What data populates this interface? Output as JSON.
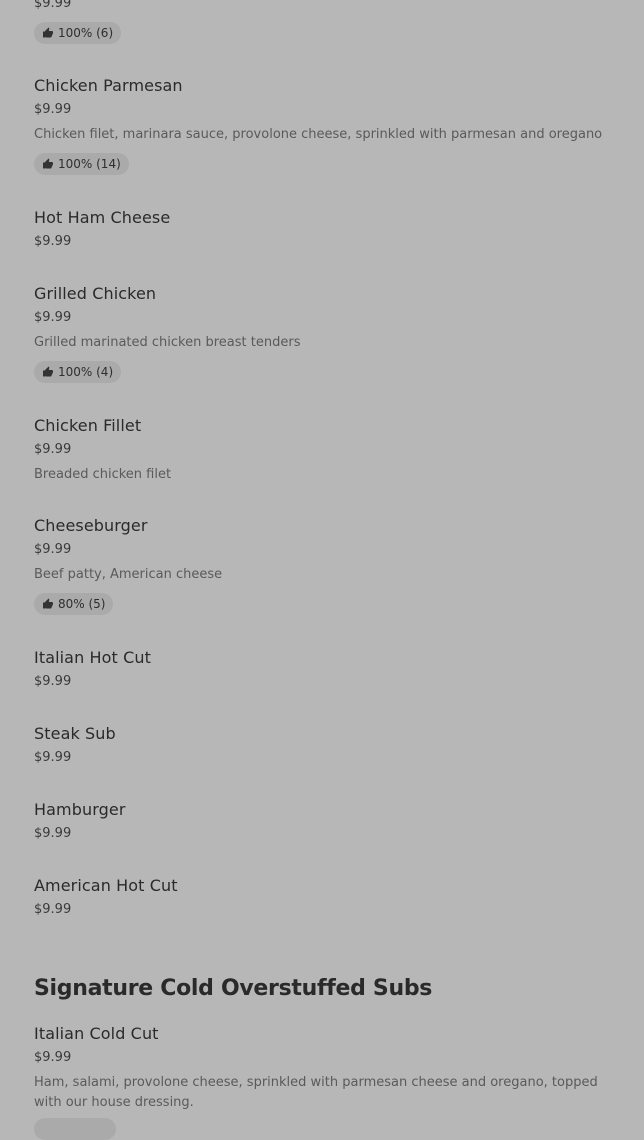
{
  "top": {
    "price": "$9.99",
    "rating": "100% (6)"
  },
  "items": [
    {
      "name": "Chicken Parmesan",
      "price": "$9.99",
      "description": "Chicken filet, marinara sauce, provolone cheese, sprinkled with parmesan and oregano",
      "rating": "100% (14)"
    },
    {
      "name": "Hot Ham Cheese",
      "price": "$9.99"
    },
    {
      "name": "Grilled Chicken",
      "price": "$9.99",
      "description": "Grilled marinated chicken breast tenders",
      "rating": "100% (4)"
    },
    {
      "name": "Chicken Fillet",
      "price": "$9.99",
      "description": "Breaded chicken filet"
    },
    {
      "name": "Cheeseburger",
      "price": "$9.99",
      "description": "Beef patty, American cheese",
      "rating": "80% (5)"
    },
    {
      "name": "Italian Hot Cut",
      "price": "$9.99"
    },
    {
      "name": "Steak Sub",
      "price": "$9.99"
    },
    {
      "name": "Hamburger",
      "price": "$9.99"
    },
    {
      "name": "American Hot Cut",
      "price": "$9.99"
    }
  ],
  "section": {
    "title": "Signature Cold Overstuffed Subs",
    "items": [
      {
        "name": "Italian Cold Cut",
        "price": "$9.99",
        "description": "Ham, salami, provolone cheese, sprinkled with parmesan cheese and oregano, topped with our house dressing."
      }
    ]
  },
  "icons": {
    "rating": "thumbs-up-icon"
  }
}
